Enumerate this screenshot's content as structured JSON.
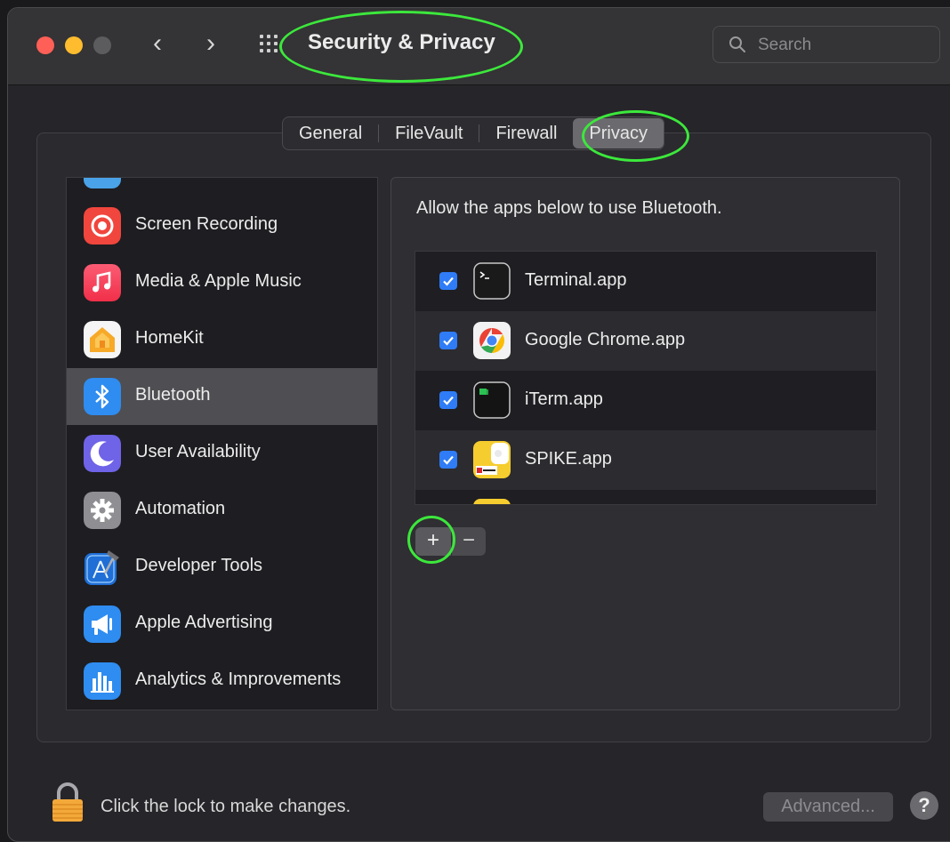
{
  "window": {
    "title": "Security & Privacy",
    "search": {
      "placeholder": "Search",
      "value": ""
    }
  },
  "tabs": [
    {
      "label": "General",
      "selected": false
    },
    {
      "label": "FileVault",
      "selected": false
    },
    {
      "label": "Firewall",
      "selected": false
    },
    {
      "label": "Privacy",
      "selected": true
    }
  ],
  "sidebar": {
    "items": [
      {
        "label": "Screen Recording",
        "icon": "screen-recording-icon"
      },
      {
        "label": "Media & Apple Music",
        "icon": "music-icon"
      },
      {
        "label": "HomeKit",
        "icon": "homekit-icon"
      },
      {
        "label": "Bluetooth",
        "icon": "bluetooth-icon",
        "selected": true
      },
      {
        "label": "User Availability",
        "icon": "moon-icon"
      },
      {
        "label": "Automation",
        "icon": "gear-icon"
      },
      {
        "label": "Developer Tools",
        "icon": "developer-tools-icon"
      },
      {
        "label": "Apple Advertising",
        "icon": "megaphone-icon"
      },
      {
        "label": "Analytics & Improvements",
        "icon": "bar-chart-icon"
      }
    ]
  },
  "detail": {
    "description": "Allow the apps below to use Bluetooth.",
    "apps": [
      {
        "name": "Terminal.app",
        "checked": true,
        "icon": "terminal-icon"
      },
      {
        "name": "Google Chrome.app",
        "checked": true,
        "icon": "chrome-icon"
      },
      {
        "name": "iTerm.app",
        "checked": true,
        "icon": "iterm-icon"
      },
      {
        "name": "SPIKE.app",
        "checked": true,
        "icon": "spike-icon"
      }
    ],
    "add_label": "+",
    "remove_label": "−"
  },
  "footer": {
    "lock_text": "Click the lock to make changes.",
    "advanced_label": "Advanced...",
    "help_label": "?"
  },
  "colors": {
    "accent": "#2f7cf6",
    "annotation": "#3ce83c",
    "traffic_close": "#fe5f57",
    "traffic_minimize": "#febc2e",
    "traffic_zoom": "#5c5c5e"
  }
}
